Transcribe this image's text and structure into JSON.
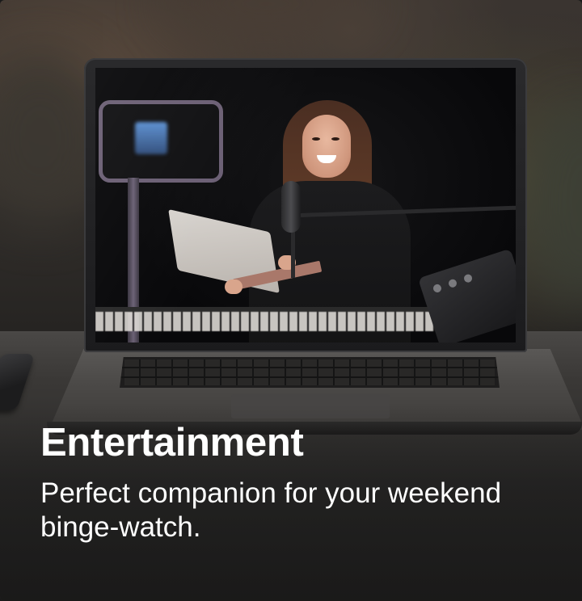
{
  "card": {
    "title": "Entertainment",
    "description": "Perfect companion for your weekend binge-watch."
  },
  "colors": {
    "text": "#ffffff",
    "background": "#2b2927"
  },
  "image": {
    "subject": "laptop-showing-video"
  }
}
